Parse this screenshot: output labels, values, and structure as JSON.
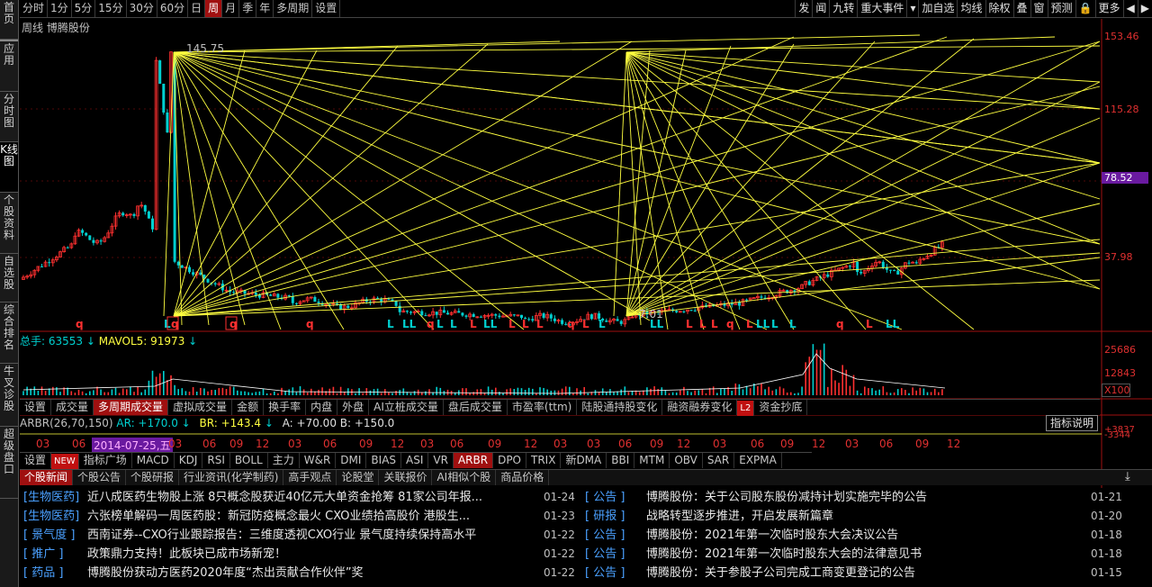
{
  "left_tabs": [
    "首页",
    "应用",
    "分时图",
    "K线图",
    "个股资料",
    "自选股",
    "综合排名",
    "牛叉诊股",
    "超级盘口"
  ],
  "periods": [
    "分时",
    "1分",
    "5分",
    "15分",
    "30分",
    "60分",
    "日",
    "周",
    "月",
    "季",
    "年",
    "多周期",
    "设置"
  ],
  "selected_period": "周",
  "top_right": [
    "发",
    "闻",
    "九转",
    "重大事件",
    "▾",
    "加自选",
    "均线",
    "除权",
    "叠",
    "窗",
    "预测",
    "🔒",
    "更多",
    "◀",
    "▶"
  ],
  "chart_title": "周线  博腾股份",
  "price_axis": [
    "153.46",
    "115.28",
    "78.52",
    "37.98"
  ],
  "high_label": "145.75",
  "low_label": "7.01",
  "volume": {
    "label": "总手: 63553",
    "mavol": "MAVOL5: 91973",
    "axis": [
      "25686",
      "12843",
      "X100"
    ]
  },
  "tabs1": [
    "设置",
    "成交量",
    "多周期成交量",
    "虚拟成交量",
    "金额",
    "换手率",
    "内盘",
    "外盘",
    "AI立桩成交量",
    "盘后成交量",
    "市盈率(ttm)",
    "陆股通持股变化",
    "融资融券变化",
    "L2",
    "资金抄底"
  ],
  "tabs1_selected": "多周期成交量",
  "indicator": {
    "name": "ARBR(26,70,150)",
    "ar": "AR: +170.0",
    "br": "BR: +143.4",
    "a": "A: +70.00",
    "b": "B: +150.0",
    "button": "指标说明",
    "axis": [
      "+3837",
      "-3344"
    ]
  },
  "xaxis": [
    "03",
    "06",
    "2014-07-25,五",
    "03",
    "06",
    "09",
    "12",
    "03",
    "06",
    "09",
    "12",
    "03",
    "06",
    "09",
    "12",
    "03",
    "03",
    "06",
    "09",
    "12",
    "03",
    "06",
    "09",
    "12",
    "03",
    "06",
    "09",
    "12"
  ],
  "tabs2": [
    "设置",
    "NEW",
    "指标广场",
    "MACD",
    "KDJ",
    "RSI",
    "BOLL",
    "主力",
    "W&R",
    "DMI",
    "BIAS",
    "ASI",
    "VR",
    "ARBR",
    "DPO",
    "TRIX",
    "新DMA",
    "BBI",
    "MTM",
    "OBV",
    "SAR",
    "EXPMA"
  ],
  "tabs2_selected": "ARBR",
  "news_tabs": [
    "个股新闻",
    "个股公告",
    "个股研报",
    "行业资讯(化学制药)",
    "高手观点",
    "论股堂",
    "关联报价",
    "AI相似个股",
    "商品价格"
  ],
  "news_tabs_selected": "个股新闻",
  "news_left": [
    {
      "cat": "[生物医药]",
      "title": "近八成医药生物股上涨 8只概念股获近40亿元大单资金抢筹 81家公司年报...",
      "date": "01-24"
    },
    {
      "cat": "[生物医药]",
      "title": "六张榜单解码一周医药股：新冠防疫概念最火 CXO业绩拾高股价 港股生...",
      "date": "01-23"
    },
    {
      "cat": "[ 景气度 ]",
      "title": "西南证券--CXO行业跟踪报告：三维度透视CXO行业 景气度持续保持高水平",
      "date": "01-22"
    },
    {
      "cat": "[  推广  ]",
      "title": "政策鼎力支持！此板块已成市场新宠！",
      "date": "01-22"
    },
    {
      "cat": "[  药品  ]",
      "title": "博腾股份获动方医药2020年度“杰出贡献合作伙伴”奖",
      "date": "01-22"
    }
  ],
  "news_right": [
    {
      "cat": "[  公告  ]",
      "title": "博腾股份：关于公司股东股份减持计划实施完毕的公告",
      "date": "01-21"
    },
    {
      "cat": "[  研报  ]",
      "title": "战略转型逐步推进，开启发展新篇章",
      "date": "01-20"
    },
    {
      "cat": "[  公告  ]",
      "title": "博腾股份：2021年第一次临时股东大会决议公告",
      "date": "01-18"
    },
    {
      "cat": "[  公告  ]",
      "title": "博腾股份：2021年第一次临时股东大会的法律意见书",
      "date": "01-18"
    },
    {
      "cat": "[  公告  ]",
      "title": "博腾股份：关于参股子公司完成工商变更登记的公告",
      "date": "01-15"
    }
  ],
  "colors": {
    "up": "#ff3030",
    "down": "#00d0d0",
    "gann": "#ffff40",
    "accent": "#a01010"
  }
}
